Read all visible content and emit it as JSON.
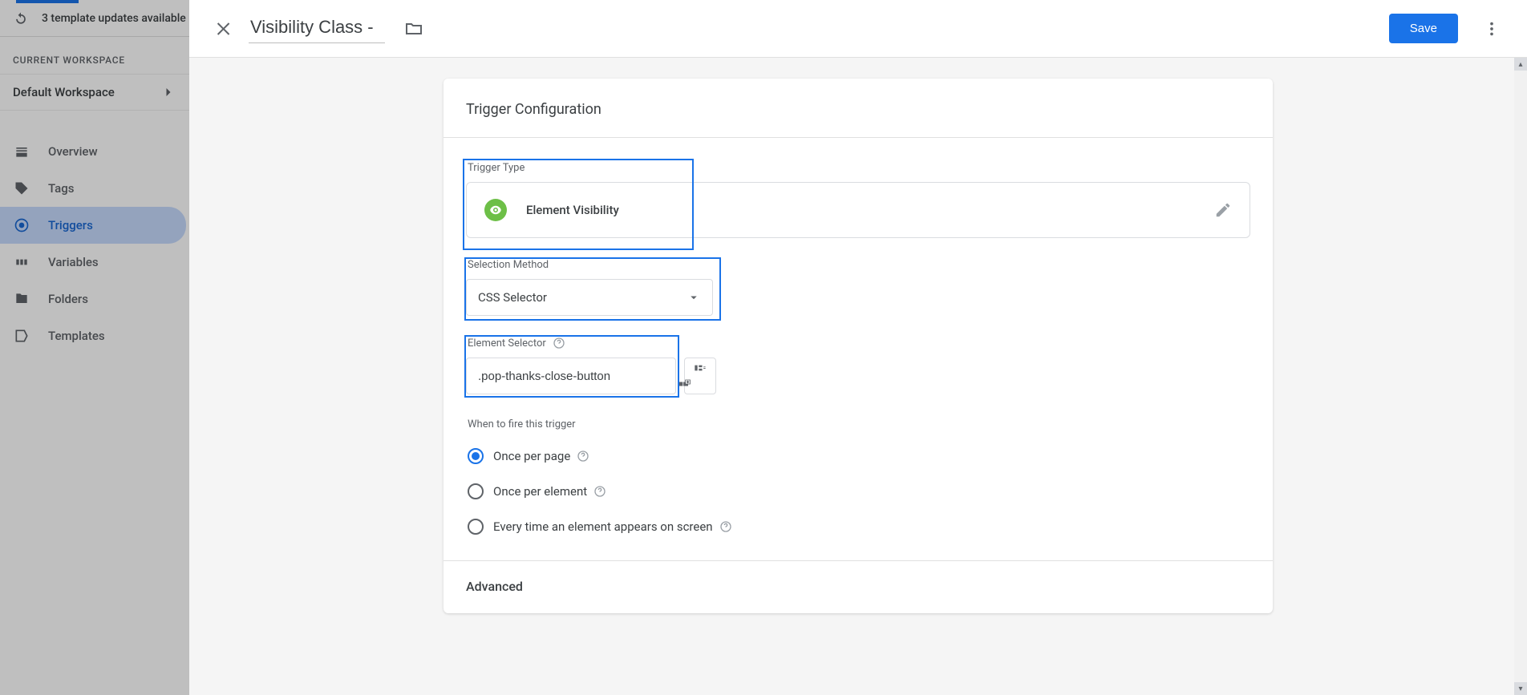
{
  "background": {
    "updates_text": "3 template updates available",
    "workspace_label": "CURRENT WORKSPACE",
    "workspace_name": "Default Workspace",
    "nav": {
      "overview": "Overview",
      "tags": "Tags",
      "triggers": "Triggers",
      "variables": "Variables",
      "folders": "Folders",
      "templates": "Templates"
    }
  },
  "sheet": {
    "title": "Visibility Class -",
    "save": "Save",
    "card_title": "Trigger Configuration",
    "trigger_type_label": "Trigger Type",
    "trigger_type_value": "Element Visibility",
    "selection_method_label": "Selection Method",
    "selection_method_value": "CSS Selector",
    "element_selector_label": "Element Selector",
    "element_selector_value": ".pop-thanks-close-button",
    "when_to_fire_label": "When to fire this trigger",
    "fire_options": {
      "once_page": "Once per page",
      "once_element": "Once per element",
      "every_time": "Every time an element appears on screen"
    },
    "advanced_label": "Advanced"
  }
}
